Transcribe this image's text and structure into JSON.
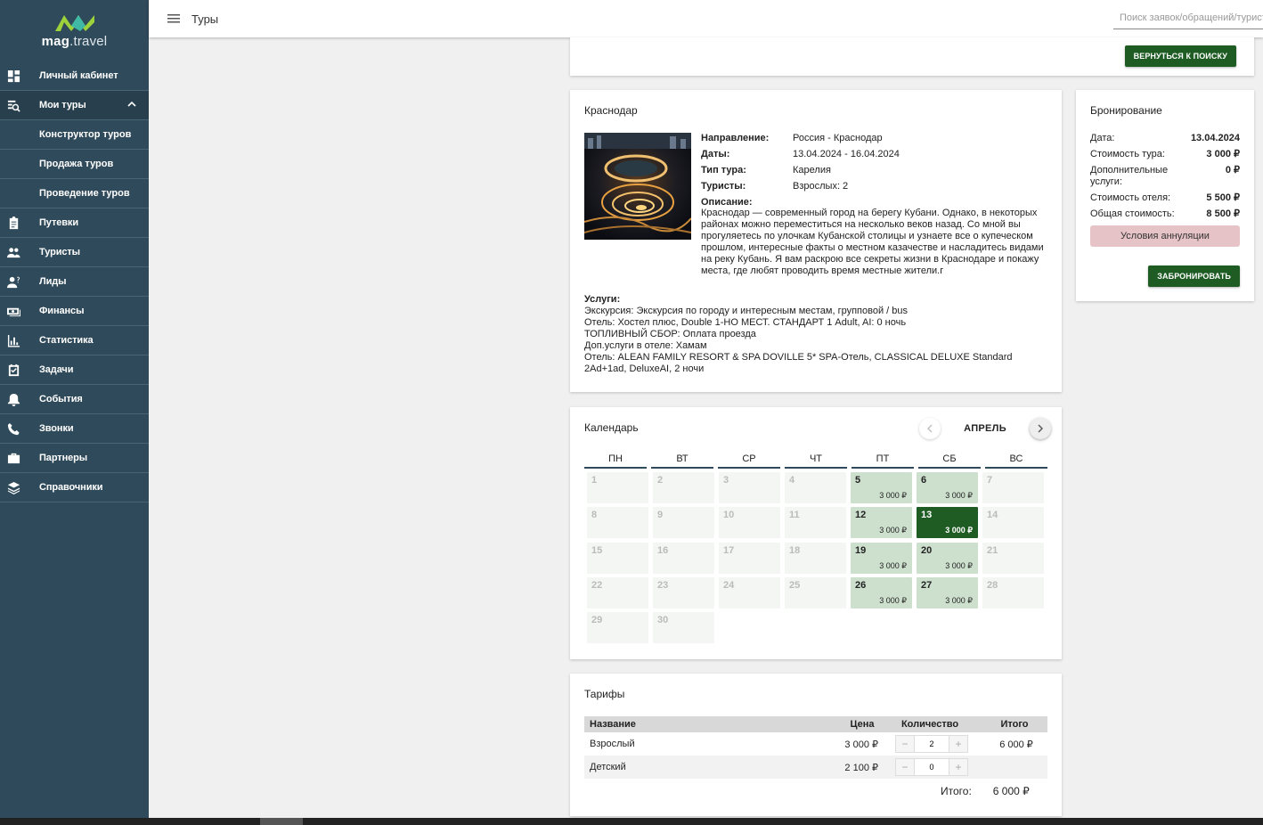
{
  "colors": {
    "sidebar": "#2f4a5a",
    "accent_green": "#1e5c23",
    "available_day": "#cde0ce",
    "cancel_pink": "#e6c3c6"
  },
  "logo": {
    "bold": "mag",
    "rest": ".travel"
  },
  "sidebar": {
    "items": [
      {
        "label": "Личный кабинет",
        "icon": "dashboard-icon"
      },
      {
        "label": "Мои туры",
        "icon": "tour-search-icon",
        "expanded": true,
        "subitems": [
          {
            "label": "Конструктор туров"
          },
          {
            "label": "Продажа туров"
          },
          {
            "label": "Проведение туров"
          }
        ]
      },
      {
        "label": "Путевки",
        "icon": "clipboard-icon"
      },
      {
        "label": "Туристы",
        "icon": "people-icon"
      },
      {
        "label": "Лиды",
        "icon": "person-question-icon"
      },
      {
        "label": "Финансы",
        "icon": "money-icon"
      },
      {
        "label": "Статистика",
        "icon": "bar-chart-icon"
      },
      {
        "label": "Задачи",
        "icon": "task-check-icon"
      },
      {
        "label": "События",
        "icon": "bell-icon"
      },
      {
        "label": "Звонки",
        "icon": "phone-icon"
      },
      {
        "label": "Партнеры",
        "icon": "briefcase-icon"
      },
      {
        "label": "Справочники",
        "icon": "layers-icon"
      }
    ]
  },
  "header": {
    "title": "Туры",
    "search_placeholder": "Поиск заявок/обращений/туристов"
  },
  "top": {
    "back_button": "ВЕРНУТЬСЯ К ПОИСКУ"
  },
  "tour": {
    "title": "Краснодар",
    "fields": [
      {
        "key": "Направление:",
        "value": "Россия - Краснодар"
      },
      {
        "key": "Даты:",
        "value": "13.04.2024 - 16.04.2024"
      },
      {
        "key": "Тип тура:",
        "value": "Карелия"
      },
      {
        "key": "Туристы:",
        "value": "Взрослых: 2"
      }
    ],
    "description_key": "Описание:",
    "description": "Краснодар — современный город на берегу Кубани. Однако, в некоторых районах можно переместиться на несколько веков назад. Со мной вы прогуляетесь по улочкам Кубанской столицы и узнаете все о купеческом прошлом, интересные факты о местном казачестве и насладитесь видами на реку Кубань. Я вам раскрою все секреты жизни в Краснодаре и покажу места, где любят проводить время местные жители.г",
    "services_key": "Услуги:",
    "services": [
      "Экскурсия: Экскурсия по городу и интересным местам, групповой / bus",
      "Отель: Хостел плюс, Double 1-НО МЕСТ. СТАНДАРТ 1 Adult, AI: 0 ночь",
      "ТОПЛИВНЫЙ СБОР: Оплата проезда",
      "Доп.услуги в отеле: Хамам",
      "Отель: ALEAN FAMILY RESORT & SPA DOVILLE 5* SPA-Отель, CLASSICAL DELUXE Standard 2Ad+1ad, DeluxeAI, 2 ночи"
    ]
  },
  "booking": {
    "title": "Бронирование",
    "rows": [
      {
        "key": "Дата:",
        "value": "13.04.2024"
      },
      {
        "key": "Стоимость тура:",
        "value": "3 000 ₽"
      },
      {
        "key": "Дополнительные услуги:",
        "value": "0 ₽"
      },
      {
        "key": "Стоимость отеля:",
        "value": "5 500 ₽"
      },
      {
        "key": "Общая стоимость:",
        "value": "8 500 ₽"
      }
    ],
    "cancel_button": "Условия аннуляции",
    "book_button": "ЗАБРОНИРОВАТЬ"
  },
  "calendar": {
    "title": "Календарь",
    "month": "АПРЕЛЬ",
    "weekdays": [
      "ПН",
      "ВТ",
      "СР",
      "ЧТ",
      "ПТ",
      "СБ",
      "ВС"
    ],
    "days": [
      {
        "d": "1"
      },
      {
        "d": "2"
      },
      {
        "d": "3"
      },
      {
        "d": "4"
      },
      {
        "d": "5",
        "price": "3 000 ₽"
      },
      {
        "d": "6",
        "price": "3 000 ₽"
      },
      {
        "d": "7"
      },
      {
        "d": "8"
      },
      {
        "d": "9"
      },
      {
        "d": "10"
      },
      {
        "d": "11"
      },
      {
        "d": "12",
        "price": "3 000 ₽"
      },
      {
        "d": "13",
        "price": "3 000 ₽",
        "selected": true
      },
      {
        "d": "14"
      },
      {
        "d": "15"
      },
      {
        "d": "16"
      },
      {
        "d": "17"
      },
      {
        "d": "18"
      },
      {
        "d": "19",
        "price": "3 000 ₽"
      },
      {
        "d": "20",
        "price": "3 000 ₽"
      },
      {
        "d": "21"
      },
      {
        "d": "22"
      },
      {
        "d": "23"
      },
      {
        "d": "24"
      },
      {
        "d": "25"
      },
      {
        "d": "26",
        "price": "3 000 ₽"
      },
      {
        "d": "27",
        "price": "3 000 ₽"
      },
      {
        "d": "28"
      },
      {
        "d": "29"
      },
      {
        "d": "30"
      }
    ]
  },
  "tariffs": {
    "title": "Тарифы",
    "columns": {
      "name": "Название",
      "price": "Цена",
      "qty": "Количество",
      "total": "Итого"
    },
    "rows": [
      {
        "name": "Взрослый",
        "price": "3 000 ₽",
        "qty": "2",
        "total": "6 000 ₽"
      },
      {
        "name": "Детский",
        "price": "2 100 ₽",
        "qty": "0",
        "total": ""
      }
    ],
    "total_label": "Итого:",
    "total_value": "6 000 ₽"
  }
}
